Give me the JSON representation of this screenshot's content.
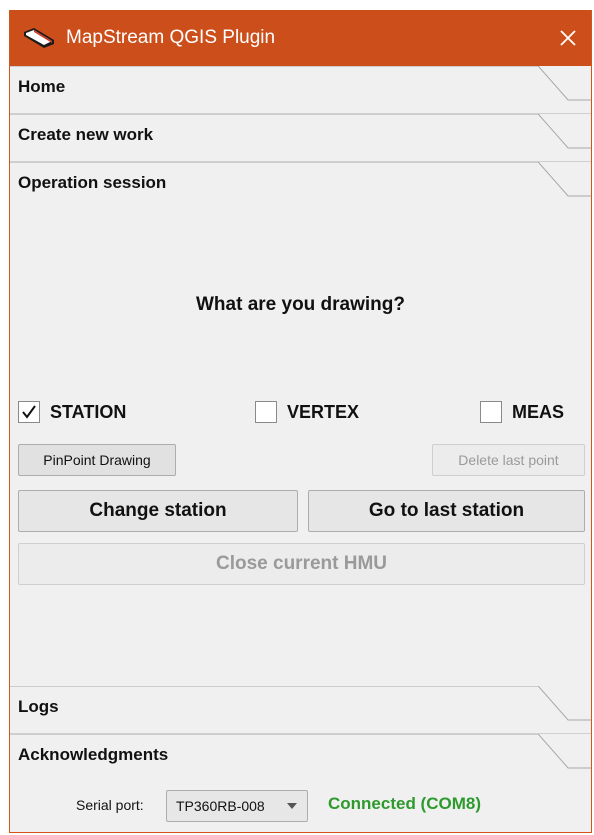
{
  "window": {
    "title": "MapStream QGIS Plugin",
    "accent_color": "#cc4e1a",
    "icons": {
      "app": "mapstream-logo-icon",
      "close": "close-icon"
    }
  },
  "tabs": [
    {
      "label": "Home"
    },
    {
      "label": "Create new work"
    },
    {
      "label": "Operation session"
    },
    {
      "label": "Logs"
    },
    {
      "label": "Acknowledgments"
    }
  ],
  "session": {
    "question": "What are you drawing?",
    "checkboxes": [
      {
        "label": "STATION",
        "checked": true
      },
      {
        "label": "VERTEX",
        "checked": false
      },
      {
        "label": "MEAS",
        "checked": false
      }
    ],
    "buttons": {
      "pinpoint": "PinPoint Drawing",
      "delete_last": "Delete last point",
      "change_station": "Change station",
      "go_last_station": "Go to last station",
      "close_hmu": "Close current HMU"
    }
  },
  "footer": {
    "serial_label": "Serial port:",
    "serial_value": "TP360RB-008",
    "status": "Connected (COM8)",
    "status_color": "#2e9a2e"
  }
}
